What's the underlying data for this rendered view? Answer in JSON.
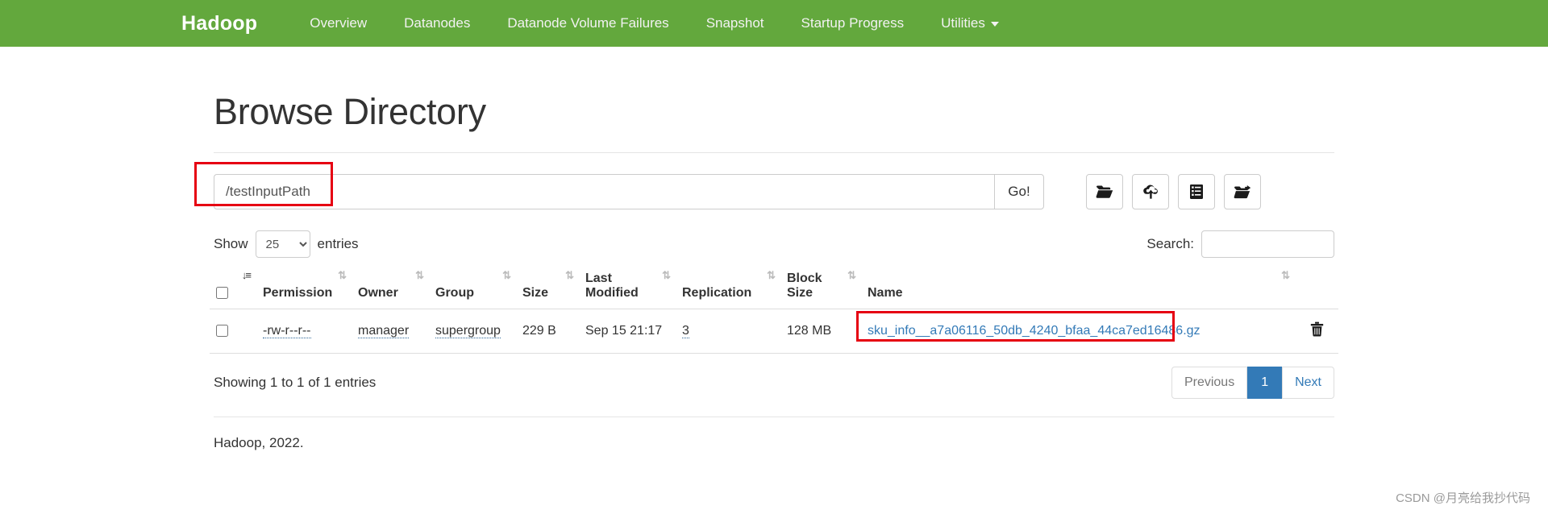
{
  "navbar": {
    "brand": "Hadoop",
    "links": [
      {
        "label": "Overview",
        "name": "nav-overview"
      },
      {
        "label": "Datanodes",
        "name": "nav-datanodes"
      },
      {
        "label": "Datanode Volume Failures",
        "name": "nav-datanode-volume-failures"
      },
      {
        "label": "Snapshot",
        "name": "nav-snapshot"
      },
      {
        "label": "Startup Progress",
        "name": "nav-startup-progress"
      },
      {
        "label": "Utilities",
        "name": "nav-utilities"
      }
    ],
    "brand_color": "#63a83d"
  },
  "page": {
    "title": "Browse Directory"
  },
  "pathbar": {
    "value": "/testInputPath",
    "placeholder": "",
    "go_label": "Go!",
    "tools": [
      {
        "icon": "folder-open-icon",
        "name": "create-directory-button"
      },
      {
        "icon": "cloud-upload-icon",
        "name": "upload-files-button"
      },
      {
        "icon": "list-icon",
        "name": "snapshot-list-button"
      },
      {
        "icon": "folder-cut-icon",
        "name": "cut-paste-button"
      }
    ]
  },
  "controls": {
    "show_label": "Show",
    "entries_label": "entries",
    "entries_value": "25",
    "entries_options": [
      "25"
    ],
    "search_label": "Search:",
    "search_value": "",
    "search_placeholder": ""
  },
  "table": {
    "headers": [
      {
        "label": "",
        "name": "th-select-all"
      },
      {
        "label": "Permission",
        "name": "th-permission"
      },
      {
        "label": "Owner",
        "name": "th-owner"
      },
      {
        "label": "Group",
        "name": "th-group"
      },
      {
        "label": "Size",
        "name": "th-size"
      },
      {
        "label": "Last Modified",
        "name": "th-last-modified"
      },
      {
        "label": "Replication",
        "name": "th-replication"
      },
      {
        "label": "Block Size",
        "name": "th-block-size"
      },
      {
        "label": "Name",
        "name": "th-name"
      }
    ],
    "header_labels": {
      "permission": "Permission",
      "owner": "Owner",
      "group": "Group",
      "size": "Size",
      "last_modified_line1": "Last",
      "last_modified_line2": "Modified",
      "replication": "Replication",
      "block_size_line1": "Block",
      "block_size_line2": "Size",
      "name": "Name"
    },
    "rows": [
      {
        "permission": "-rw-r--r--",
        "owner": "manager",
        "group": "supergroup",
        "size": "229 B",
        "last_modified": "Sep 15 21:17",
        "replication": "3",
        "block_size": "128 MB",
        "name": "sku_info__a7a06116_50db_4240_bfaa_44ca7ed16486.gz"
      }
    ]
  },
  "footer": {
    "showing": "Showing 1 to 1 of 1 entries",
    "pagination": {
      "previous": "Previous",
      "page": "1",
      "next": "Next"
    },
    "copyright": "Hadoop, 2022."
  },
  "watermark": "CSDN @月亮给我抄代码",
  "colors": {
    "navbar_green": "#63a83d",
    "link_blue": "#337ab7",
    "highlight_red": "#e60012"
  }
}
